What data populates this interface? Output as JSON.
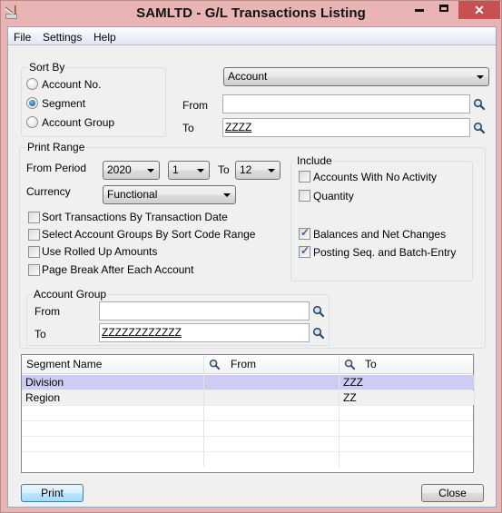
{
  "window": {
    "title": "SAMLTD - G/L Transactions Listing",
    "controls": {
      "minimize": "minimize",
      "maximize": "maximize",
      "close": "✕"
    }
  },
  "menu": {
    "items": [
      "File",
      "Settings",
      "Help"
    ]
  },
  "sort_by": {
    "label": "Sort By",
    "options": [
      {
        "label": "Account No.",
        "selected": false
      },
      {
        "label": "Segment",
        "selected": true
      },
      {
        "label": "Account Group",
        "selected": false
      }
    ],
    "segment_select": "Account",
    "from_label": "From",
    "from_value": "",
    "to_label": "To",
    "to_value": "ZZZZ"
  },
  "print_range": {
    "label": "Print Range",
    "from_period_label": "From Period",
    "year": "2020",
    "from_period": "1",
    "to_label": "To",
    "to_period": "12",
    "currency_label": "Currency",
    "currency": "Functional",
    "options": [
      {
        "label": "Sort Transactions By Transaction Date",
        "checked": false
      },
      {
        "label": "Select Account Groups By Sort Code Range",
        "checked": false
      },
      {
        "label": "Use Rolled Up Amounts",
        "checked": false
      },
      {
        "label": "Page Break After Each Account",
        "checked": false
      }
    ],
    "include": {
      "label": "Include",
      "options": [
        {
          "label": "Accounts With No Activity",
          "checked": false
        },
        {
          "label": "Quantity",
          "checked": false
        },
        {
          "label": "Balances and Net Changes",
          "checked": true
        },
        {
          "label": "Posting Seq. and Batch-Entry",
          "checked": true
        }
      ]
    },
    "account_group": {
      "label": "Account Group",
      "from_label": "From",
      "from_value": "",
      "to_label": "To",
      "to_value": "ZZZZZZZZZZZZ"
    }
  },
  "segment_grid": {
    "columns": [
      "Segment Name",
      "From",
      "To"
    ],
    "rows": [
      {
        "name": "Division",
        "from": "",
        "to": "ZZZ",
        "selected": true
      },
      {
        "name": "Region",
        "from": "",
        "to": "ZZ",
        "selected": false
      }
    ]
  },
  "buttons": {
    "print": "Print",
    "close": "Close"
  }
}
